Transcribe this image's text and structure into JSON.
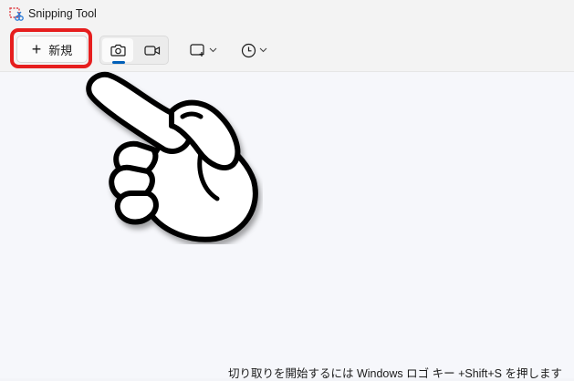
{
  "window": {
    "title": "Snipping Tool"
  },
  "toolbar": {
    "new_label": "新規",
    "modes": [
      {
        "name": "screenshot",
        "icon": "camera-icon",
        "selected": true
      },
      {
        "name": "record",
        "icon": "video-camera-icon",
        "selected": false
      }
    ],
    "shape_icon": "rectangle-snip-icon",
    "delay_icon": "clock-icon"
  },
  "main": {
    "hint": "切り取りを開始するには Windows ロゴ キー +Shift+S を押します"
  },
  "annotation": {
    "highlight_color": "#e61e1e",
    "pointer": "pointing-hand-icon"
  },
  "colors": {
    "accent": "#005fb8"
  }
}
